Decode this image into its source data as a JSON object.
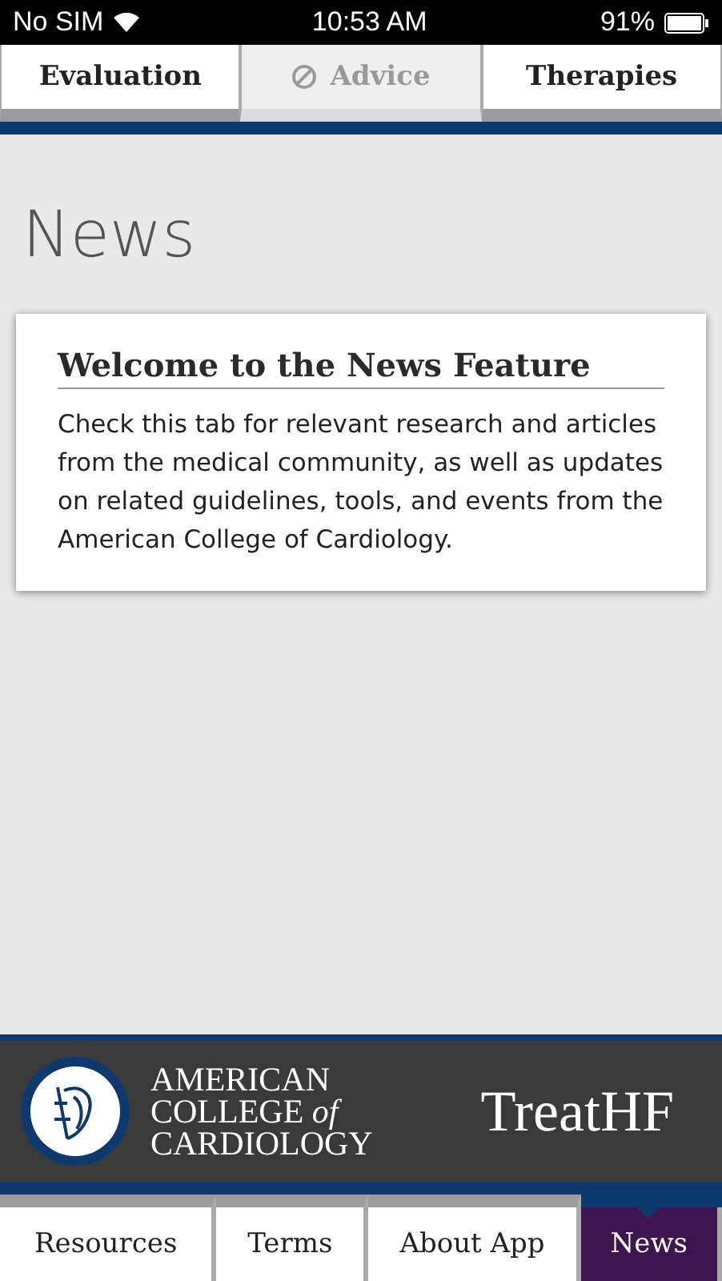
{
  "status_bar": {
    "carrier": "No SIM",
    "time": "10:53 AM",
    "battery": "91%"
  },
  "top_tabs": [
    {
      "label": "Evaluation",
      "disabled": false
    },
    {
      "label": "Advice",
      "disabled": true
    },
    {
      "label": "Therapies",
      "disabled": false
    }
  ],
  "page_title": "News",
  "card": {
    "title": "Welcome to the News Feature",
    "body": "Check this tab for relevant research and articles from the medical community, as well as updates on related guidelines, tools, and events from the American College of Cardiology."
  },
  "footer": {
    "logo_lines": [
      "AMERICAN",
      "COLLEGE *of*",
      "CARDIOLOGY"
    ],
    "app_name": "TreatHF"
  },
  "bottom_tabs": [
    {
      "label": "Resources",
      "selected": false
    },
    {
      "label": "Terms",
      "selected": false
    },
    {
      "label": "About App",
      "selected": false
    },
    {
      "label": "News",
      "selected": true
    }
  ]
}
